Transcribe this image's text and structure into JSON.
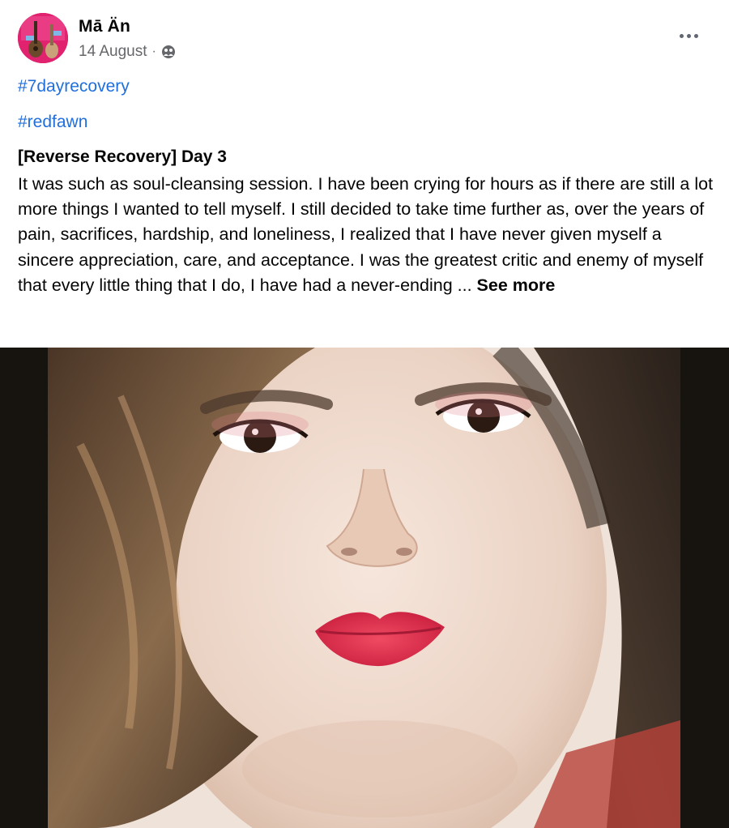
{
  "post": {
    "author": "Mā Än",
    "date": "14 August",
    "separator": "·",
    "audience_icon": "friends-icon",
    "hashtags": [
      "#7dayrecovery",
      "#redfawn"
    ],
    "title": "[Reverse Recovery] Day 3",
    "body": "It was such as soul-cleansing session. I have been crying for hours as if there are still a lot more things I wanted to tell myself. I still decided to take time further as, over the years of pain, sacrifices, hardship, and loneliness, I realized that I have never given myself a sincere appreciation, care, and acceptance. I was the greatest critic and enemy of myself that every little thing that I do, I have had a never-ending ... ",
    "see_more": "See more",
    "photo_alt": "Close-up selfie portrait"
  },
  "colors": {
    "link": "#216fdb",
    "muted": "#65676b",
    "text": "#050505",
    "photo_bg": "#17140f"
  }
}
